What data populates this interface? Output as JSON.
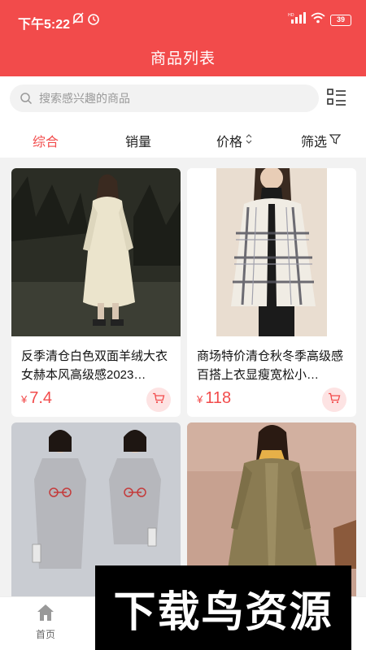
{
  "status_bar": {
    "time": "下午5:22",
    "battery": "39"
  },
  "header": {
    "title": "商品列表"
  },
  "search": {
    "placeholder": "搜索感兴趣的商品"
  },
  "sort_bar": {
    "items": [
      "综合",
      "销量",
      "价格",
      "筛选"
    ],
    "active": "综合"
  },
  "products": [
    {
      "title": "反季清仓白色双面羊绒大衣女赫本风高级感2023…",
      "currency": "¥",
      "price": "7.4",
      "image": "cream-long-coat-photo"
    },
    {
      "title": "商场特价清仓秋冬季高级感百搭上衣显瘦宽松小…",
      "currency": "¥",
      "price": "118",
      "image": "plaid-cardigan-photo"
    },
    {
      "title": "",
      "currency": "",
      "price": "",
      "image": "grey-tshirt-dress-photo"
    },
    {
      "title": "",
      "currency": "",
      "price": "",
      "image": "khaki-trench-coat-photo"
    }
  ],
  "tabbar": {
    "items": [
      "首页"
    ]
  },
  "watermark": {
    "text": "下载鸟资源"
  },
  "colors": {
    "brand_red": "#f24b4b",
    "cart_bg": "#fde3e3"
  }
}
